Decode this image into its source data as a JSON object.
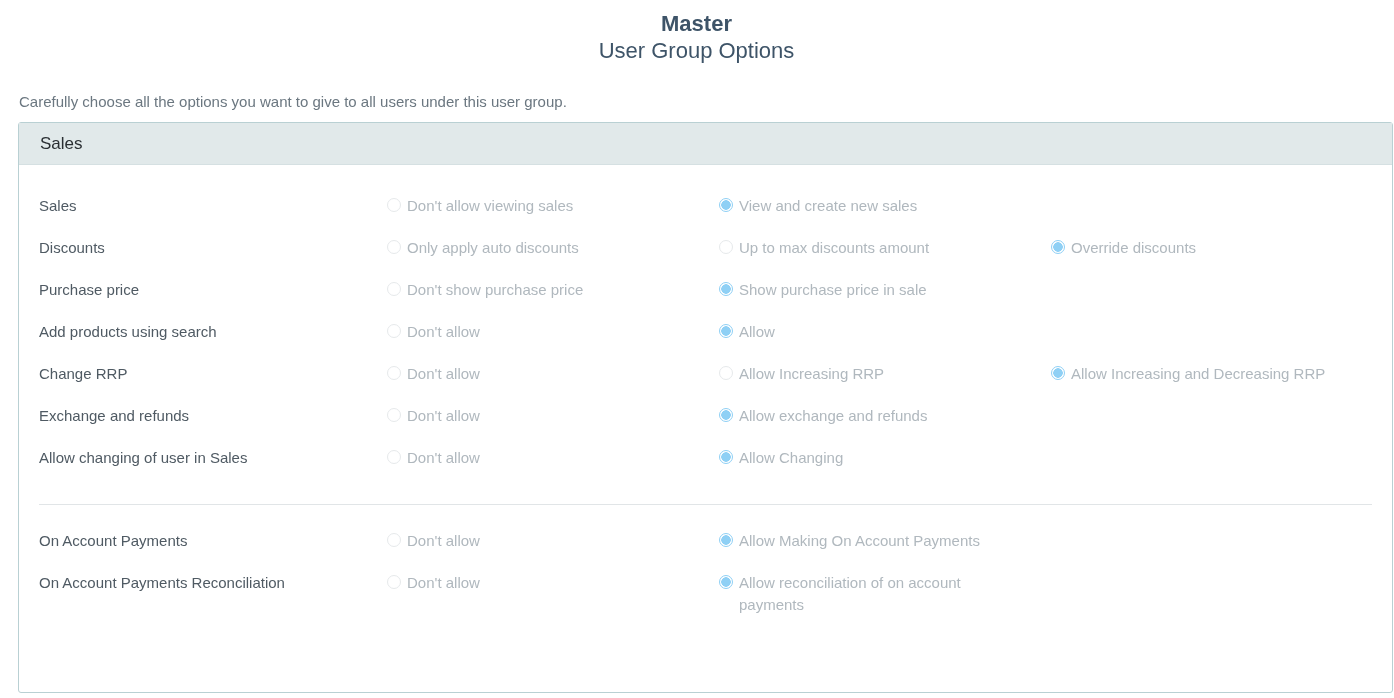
{
  "header": {
    "title": "Master",
    "subtitle": "User Group Options"
  },
  "intro": "Carefully choose all the options you want to give to all users under this user group.",
  "panel": {
    "title": "Sales",
    "groups": [
      {
        "rows": [
          {
            "label": "Sales",
            "options": [
              {
                "label": "Don't allow viewing sales",
                "selected": false
              },
              {
                "label": "View and create new sales",
                "selected": true
              }
            ]
          },
          {
            "label": "Discounts",
            "options": [
              {
                "label": "Only apply auto discounts",
                "selected": false
              },
              {
                "label": "Up to max discounts amount",
                "selected": false
              },
              {
                "label": "Override discounts",
                "selected": true
              }
            ]
          },
          {
            "label": "Purchase price",
            "options": [
              {
                "label": "Don't show purchase price",
                "selected": false
              },
              {
                "label": "Show purchase price in sale",
                "selected": true
              }
            ]
          },
          {
            "label": "Add products using search",
            "options": [
              {
                "label": "Don't allow",
                "selected": false
              },
              {
                "label": "Allow",
                "selected": true
              }
            ]
          },
          {
            "label": "Change RRP",
            "options": [
              {
                "label": "Don't allow",
                "selected": false
              },
              {
                "label": "Allow Increasing RRP",
                "selected": false
              },
              {
                "label": "Allow Increasing and Decreasing RRP",
                "selected": true
              }
            ]
          },
          {
            "label": "Exchange and refunds",
            "options": [
              {
                "label": "Don't allow",
                "selected": false
              },
              {
                "label": "Allow exchange and refunds",
                "selected": true
              }
            ]
          },
          {
            "label": "Allow changing of user in Sales",
            "options": [
              {
                "label": "Don't allow",
                "selected": false
              },
              {
                "label": "Allow Changing",
                "selected": true
              }
            ]
          }
        ]
      },
      {
        "rows": [
          {
            "label": "On Account Payments",
            "options": [
              {
                "label": "Don't allow",
                "selected": false
              },
              {
                "label": "Allow Making On Account Payments",
                "selected": true
              }
            ]
          },
          {
            "label": "On Account Payments Reconciliation",
            "options": [
              {
                "label": "Don't allow",
                "selected": false
              },
              {
                "label": "Allow reconciliation of on account payments",
                "selected": true
              }
            ]
          }
        ]
      }
    ]
  }
}
